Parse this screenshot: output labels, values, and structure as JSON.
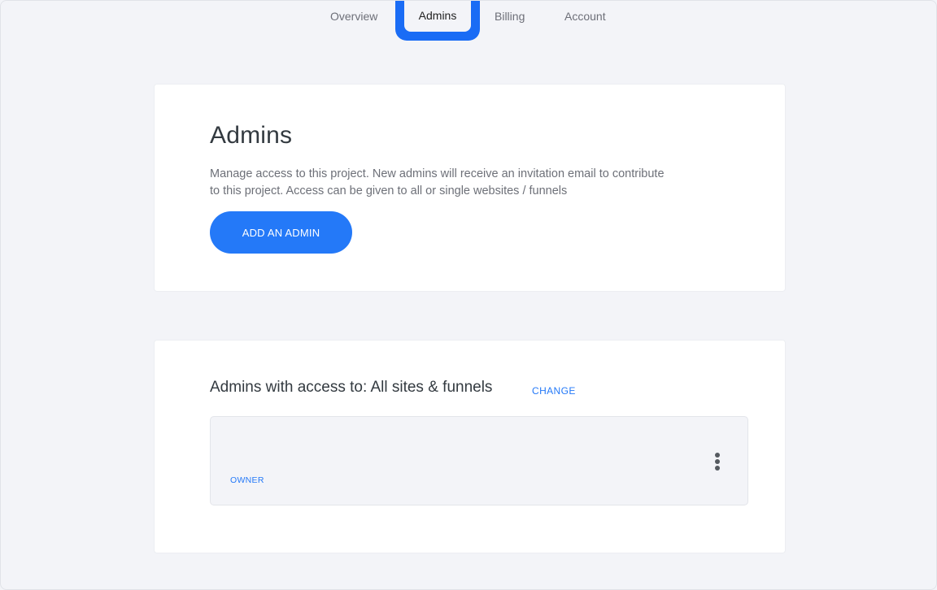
{
  "nav": {
    "tabs": [
      {
        "label": "Overview"
      },
      {
        "label": "Admins",
        "active": true
      },
      {
        "label": "Billing"
      },
      {
        "label": "Account"
      }
    ]
  },
  "admins_card": {
    "title": "Admins",
    "description": "Manage access to this project. New admins will receive an invitation email to contribute to this project. Access can be given to all or single websites / funnels",
    "add_button_label": "ADD AN ADMIN"
  },
  "access_card": {
    "title": "Admins with access to: All sites & funnels",
    "change_label": "CHANGE",
    "admins": [
      {
        "role": "OWNER",
        "menu_icon": "more-vertical-icon"
      }
    ]
  },
  "colors": {
    "accent": "#2479f8",
    "highlight": "#1a6cf5",
    "background": "#f3f4f8"
  }
}
